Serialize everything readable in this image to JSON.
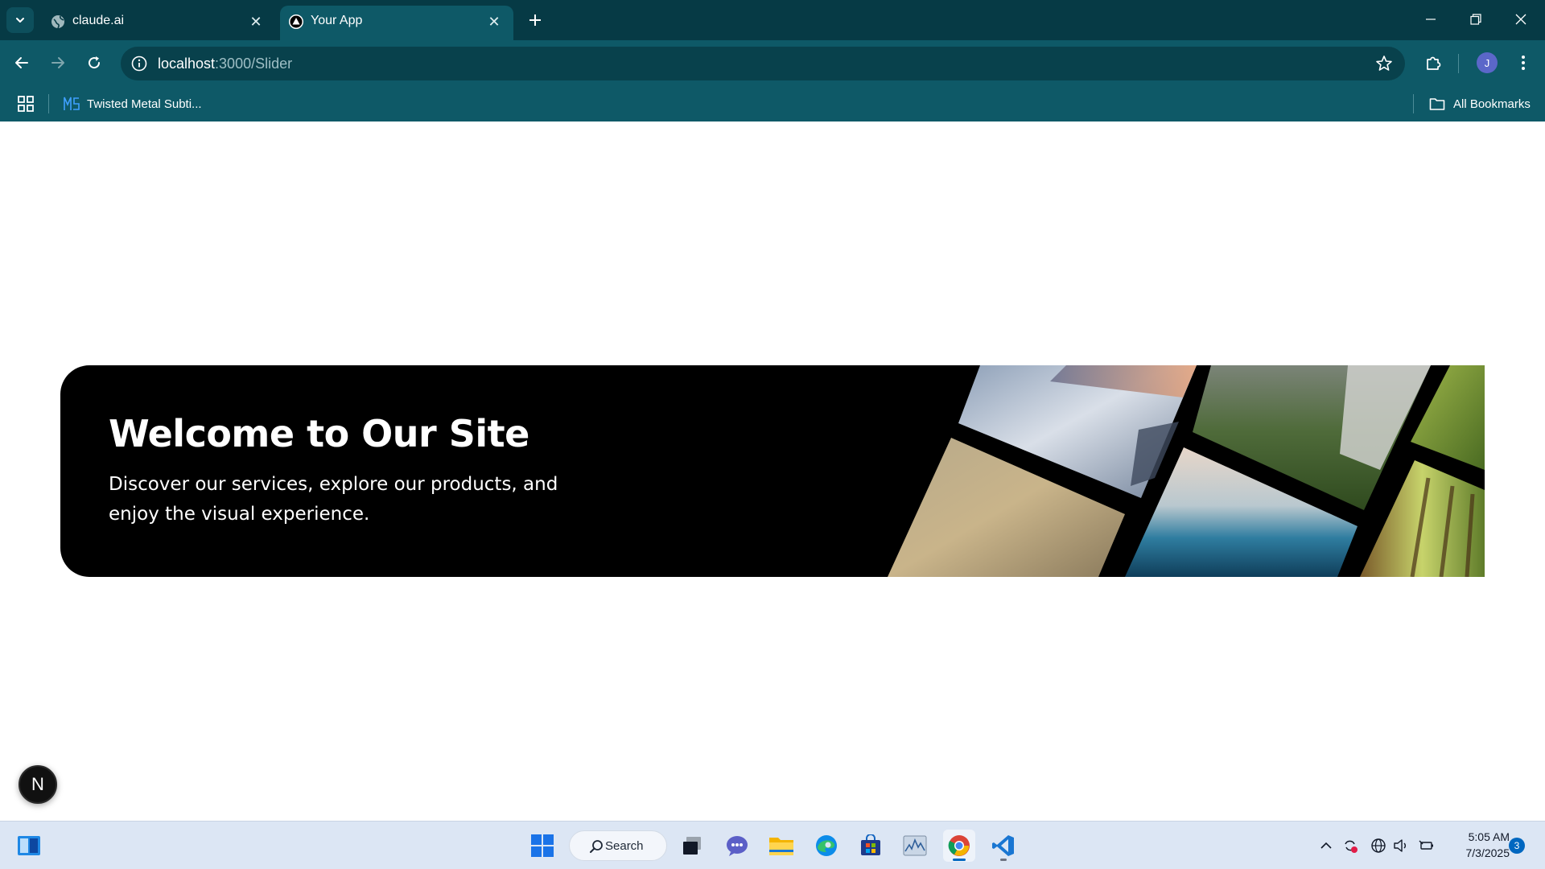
{
  "browser": {
    "tabs": [
      {
        "title": "claude.ai",
        "active": false
      },
      {
        "title": "Your App",
        "active": true
      }
    ],
    "address": {
      "host": "localhost",
      "path": ":3000/Slider"
    },
    "profile_initial": "J",
    "bookmarks": [
      {
        "label": "Twisted Metal Subti..."
      }
    ],
    "all_bookmarks_label": "All Bookmarks"
  },
  "page": {
    "hero": {
      "title": "Welcome to Our Site",
      "subtitle": "Discover our services, explore our products, and enjoy the visual experience."
    },
    "dev_badge": "N"
  },
  "taskbar": {
    "search_label": "Search",
    "clock_time": "5:05 AM",
    "clock_date": "7/3/2025",
    "notification_count": "3"
  },
  "colors": {
    "tabstrip": "#063a45",
    "toolbar": "#0e5967",
    "hero_background": "#000000",
    "taskbar": "#dce6f4"
  }
}
